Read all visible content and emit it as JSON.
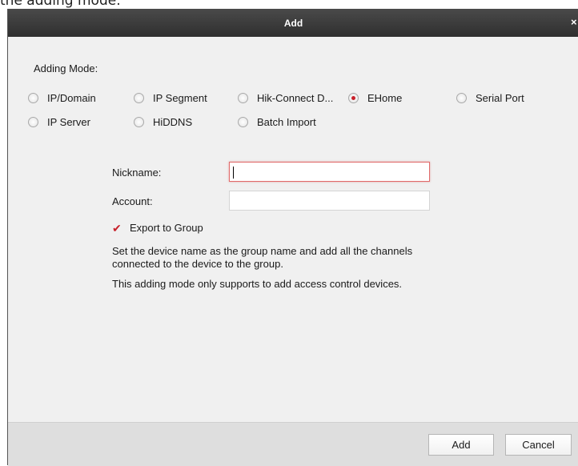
{
  "caption": "the adding mode.",
  "dialog": {
    "title": "Add",
    "close_glyph": "×",
    "adding_mode_label": "Adding Mode:",
    "modes": [
      {
        "label": "IP/Domain",
        "selected": false
      },
      {
        "label": "IP Segment",
        "selected": false
      },
      {
        "label": "Hik-Connect D...",
        "selected": false
      },
      {
        "label": "EHome",
        "selected": true
      },
      {
        "label": "Serial Port",
        "selected": false
      },
      {
        "label": "IP Server",
        "selected": false
      },
      {
        "label": "HiDDNS",
        "selected": false
      },
      {
        "label": "Batch Import",
        "selected": false
      }
    ],
    "nickname": {
      "label": "Nickname:",
      "value": ""
    },
    "account": {
      "label": "Account:",
      "value": ""
    },
    "export_to_group": {
      "label": "Export to Group",
      "checked": true
    },
    "description_line1": "Set the device name as the group name and add all the channels",
    "description_line2": "connected to the device to the group.",
    "note": "This adding mode only supports to add access control devices.",
    "add_button": "Add",
    "cancel_button": "Cancel"
  },
  "colors": {
    "accent": "#c8202a",
    "titlebar": "#3a3a3a",
    "body_bg": "#f0f0f0",
    "footer_bg": "#dedede"
  }
}
